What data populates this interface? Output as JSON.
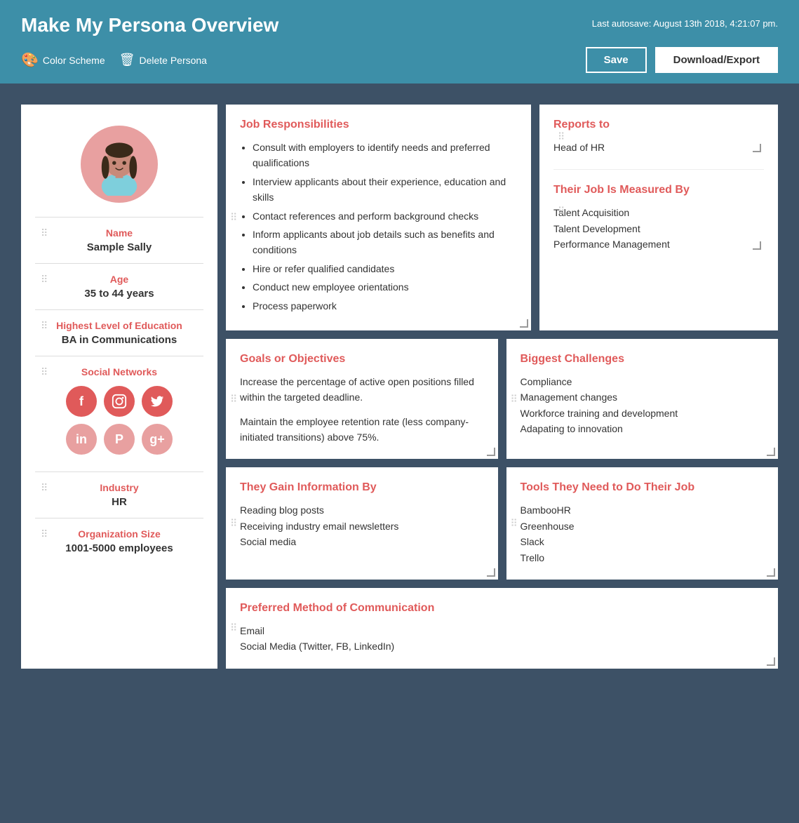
{
  "header": {
    "title": "Make My Persona Overview",
    "autosave": "Last autosave: August 13th 2018, 4:21:07 pm.",
    "color_scheme_label": "Color Scheme",
    "delete_persona_label": "Delete Persona",
    "save_label": "Save",
    "download_label": "Download/Export"
  },
  "left_panel": {
    "name_label": "Name",
    "name_value": "Sample Sally",
    "age_label": "Age",
    "age_value": "35 to 44 years",
    "education_label": "Highest Level of Education",
    "education_value": "BA in Communications",
    "social_label": "Social Networks",
    "industry_label": "Industry",
    "industry_value": "HR",
    "org_size_label": "Organization Size",
    "org_size_value": "1001-5000 employees"
  },
  "job_responsibilities": {
    "title": "Job Responsibilities",
    "items": [
      "Consult with employers to identify needs and preferred qualifications",
      "Interview applicants about their experience, education and skills",
      "Contact references and perform background checks",
      "Inform applicants about job details such as benefits and conditions",
      "Hire or refer qualified candidates",
      "Conduct new employee orientations",
      "Process paperwork"
    ]
  },
  "reports_to": {
    "title": "Reports to",
    "value": "Head of HR"
  },
  "job_measured": {
    "title": "Their Job Is Measured By",
    "items": [
      "Talent Acquisition",
      "Talent Development",
      "Performance Management"
    ]
  },
  "goals": {
    "title": "Goals or Objectives",
    "paragraph1": "Increase the percentage of active open positions filled within the targeted deadline.",
    "paragraph2": "Maintain the employee retention rate (less company-initiated transitions) above 75%."
  },
  "challenges": {
    "title": "Biggest Challenges",
    "items": [
      "Compliance",
      "Management changes",
      "Workforce training and development",
      "Adapating to innovation"
    ]
  },
  "gain_info": {
    "title": "They Gain Information By",
    "items": [
      "Reading blog posts",
      "Receiving industry email newsletters",
      "Social media"
    ]
  },
  "tools": {
    "title": "Tools They Need to Do Their Job",
    "items": [
      "BambooHR",
      "Greenhouse",
      "Slack",
      "Trello"
    ]
  },
  "communication": {
    "title": "Preferred Method of Communication",
    "items": [
      "Email",
      "Social Media (Twitter, FB, LinkedIn)"
    ]
  }
}
